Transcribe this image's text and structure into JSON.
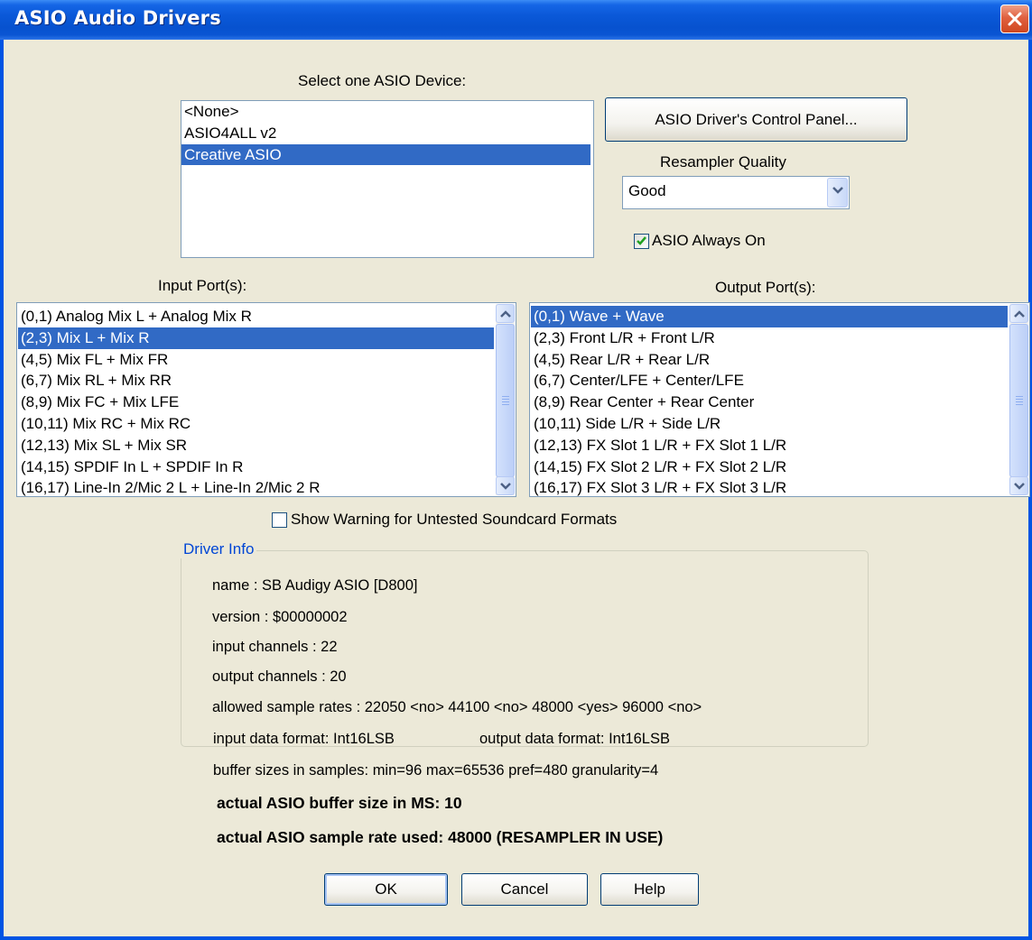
{
  "window": {
    "title": "ASIO Audio Drivers"
  },
  "device": {
    "label": "Select one ASIO Device:",
    "items": [
      "<None>",
      "ASIO4ALL v2",
      "Creative ASIO"
    ],
    "selected_index": 2
  },
  "control_panel_button": "ASIO Driver's Control Panel...",
  "resampler": {
    "label": "Resampler Quality",
    "value": "Good"
  },
  "always_on": {
    "label": "ASIO Always On",
    "checked": true
  },
  "input_ports": {
    "label": "Input Port(s):",
    "items": [
      "(0,1) Analog Mix L + Analog Mix R",
      "(2,3) Mix L + Mix R",
      "(4,5) Mix FL + Mix FR",
      "(6,7) Mix RL + Mix RR",
      "(8,9) Mix FC + Mix LFE",
      "(10,11) Mix RC + Mix RC",
      "(12,13) Mix SL + Mix SR",
      "(14,15) SPDIF In L + SPDIF In R",
      "(16,17) Line-In 2/Mic 2 L + Line-In 2/Mic 2 R"
    ],
    "selected_index": 1
  },
  "output_ports": {
    "label": "Output Port(s):",
    "items": [
      "(0,1) Wave + Wave",
      "(2,3) Front L/R + Front L/R",
      "(4,5) Rear L/R + Rear L/R",
      "(6,7) Center/LFE + Center/LFE",
      "(8,9) Rear Center + Rear Center",
      "(10,11) Side L/R + Side L/R",
      "(12,13) FX Slot 1 L/R + FX Slot 1 L/R",
      "(14,15) FX Slot 2 L/R + FX Slot 2 L/R",
      "(16,17) FX Slot 3 L/R + FX Slot 3 L/R"
    ],
    "selected_index": 0
  },
  "show_warning": {
    "label": "Show Warning for Untested Soundcard Formats",
    "checked": false
  },
  "driver_info": {
    "title": "Driver Info",
    "name": "name : SB Audigy ASIO [D800]",
    "version": "version : $00000002",
    "input_channels": "input channels : 22",
    "output_channels": "output channels : 20",
    "sample_rates": "allowed sample rates : 22050 <no> 44100 <no> 48000 <yes> 96000 <no>",
    "input_format": "input data format: Int16LSB",
    "output_format": "output data format: Int16LSB",
    "buffer_sizes": "buffer sizes in samples: min=96 max=65536 pref=480 granularity=4",
    "buffer_ms": "actual ASIO buffer size in MS: 10",
    "sample_rate_used": "actual ASIO sample rate used: 48000 (RESAMPLER IN USE)"
  },
  "buttons": {
    "ok": "OK",
    "cancel": "Cancel",
    "help": "Help"
  }
}
